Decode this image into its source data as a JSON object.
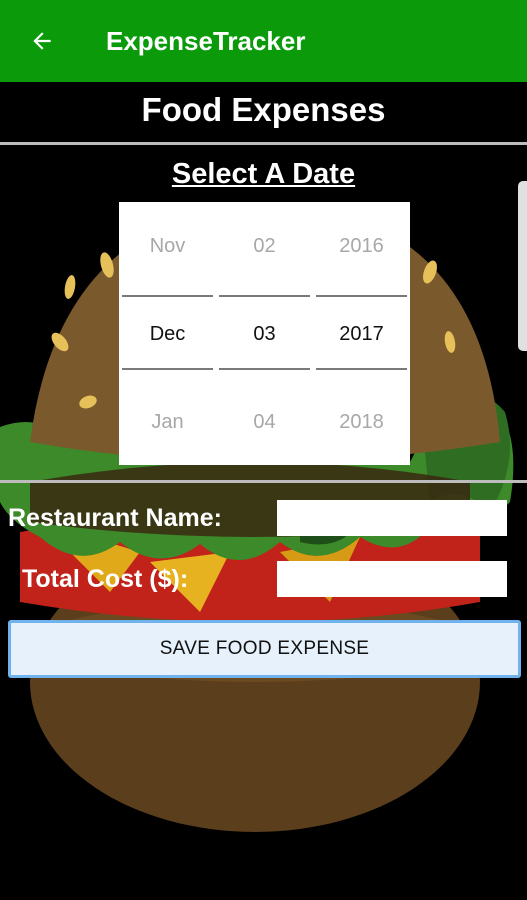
{
  "appbar": {
    "title": "ExpenseTracker",
    "back_icon": "arrow-left-icon",
    "color": "#0a9a0a"
  },
  "page": {
    "title": "Food Expenses",
    "select_date_label": "Select A Date"
  },
  "date_picker": {
    "months": [
      "Nov",
      "Dec",
      "Jan"
    ],
    "days": [
      "02",
      "03",
      "04"
    ],
    "years": [
      "2016",
      "2017",
      "2018"
    ],
    "selected": {
      "month": "Dec",
      "day": "03",
      "year": "2017"
    }
  },
  "form": {
    "restaurant_label": "Restaurant Name:",
    "restaurant_value": "",
    "total_cost_label": "Total Cost ($):",
    "total_cost_value": "",
    "save_label": "SAVE FOOD EXPENSE"
  },
  "background": {
    "image": "burger-illustration"
  }
}
